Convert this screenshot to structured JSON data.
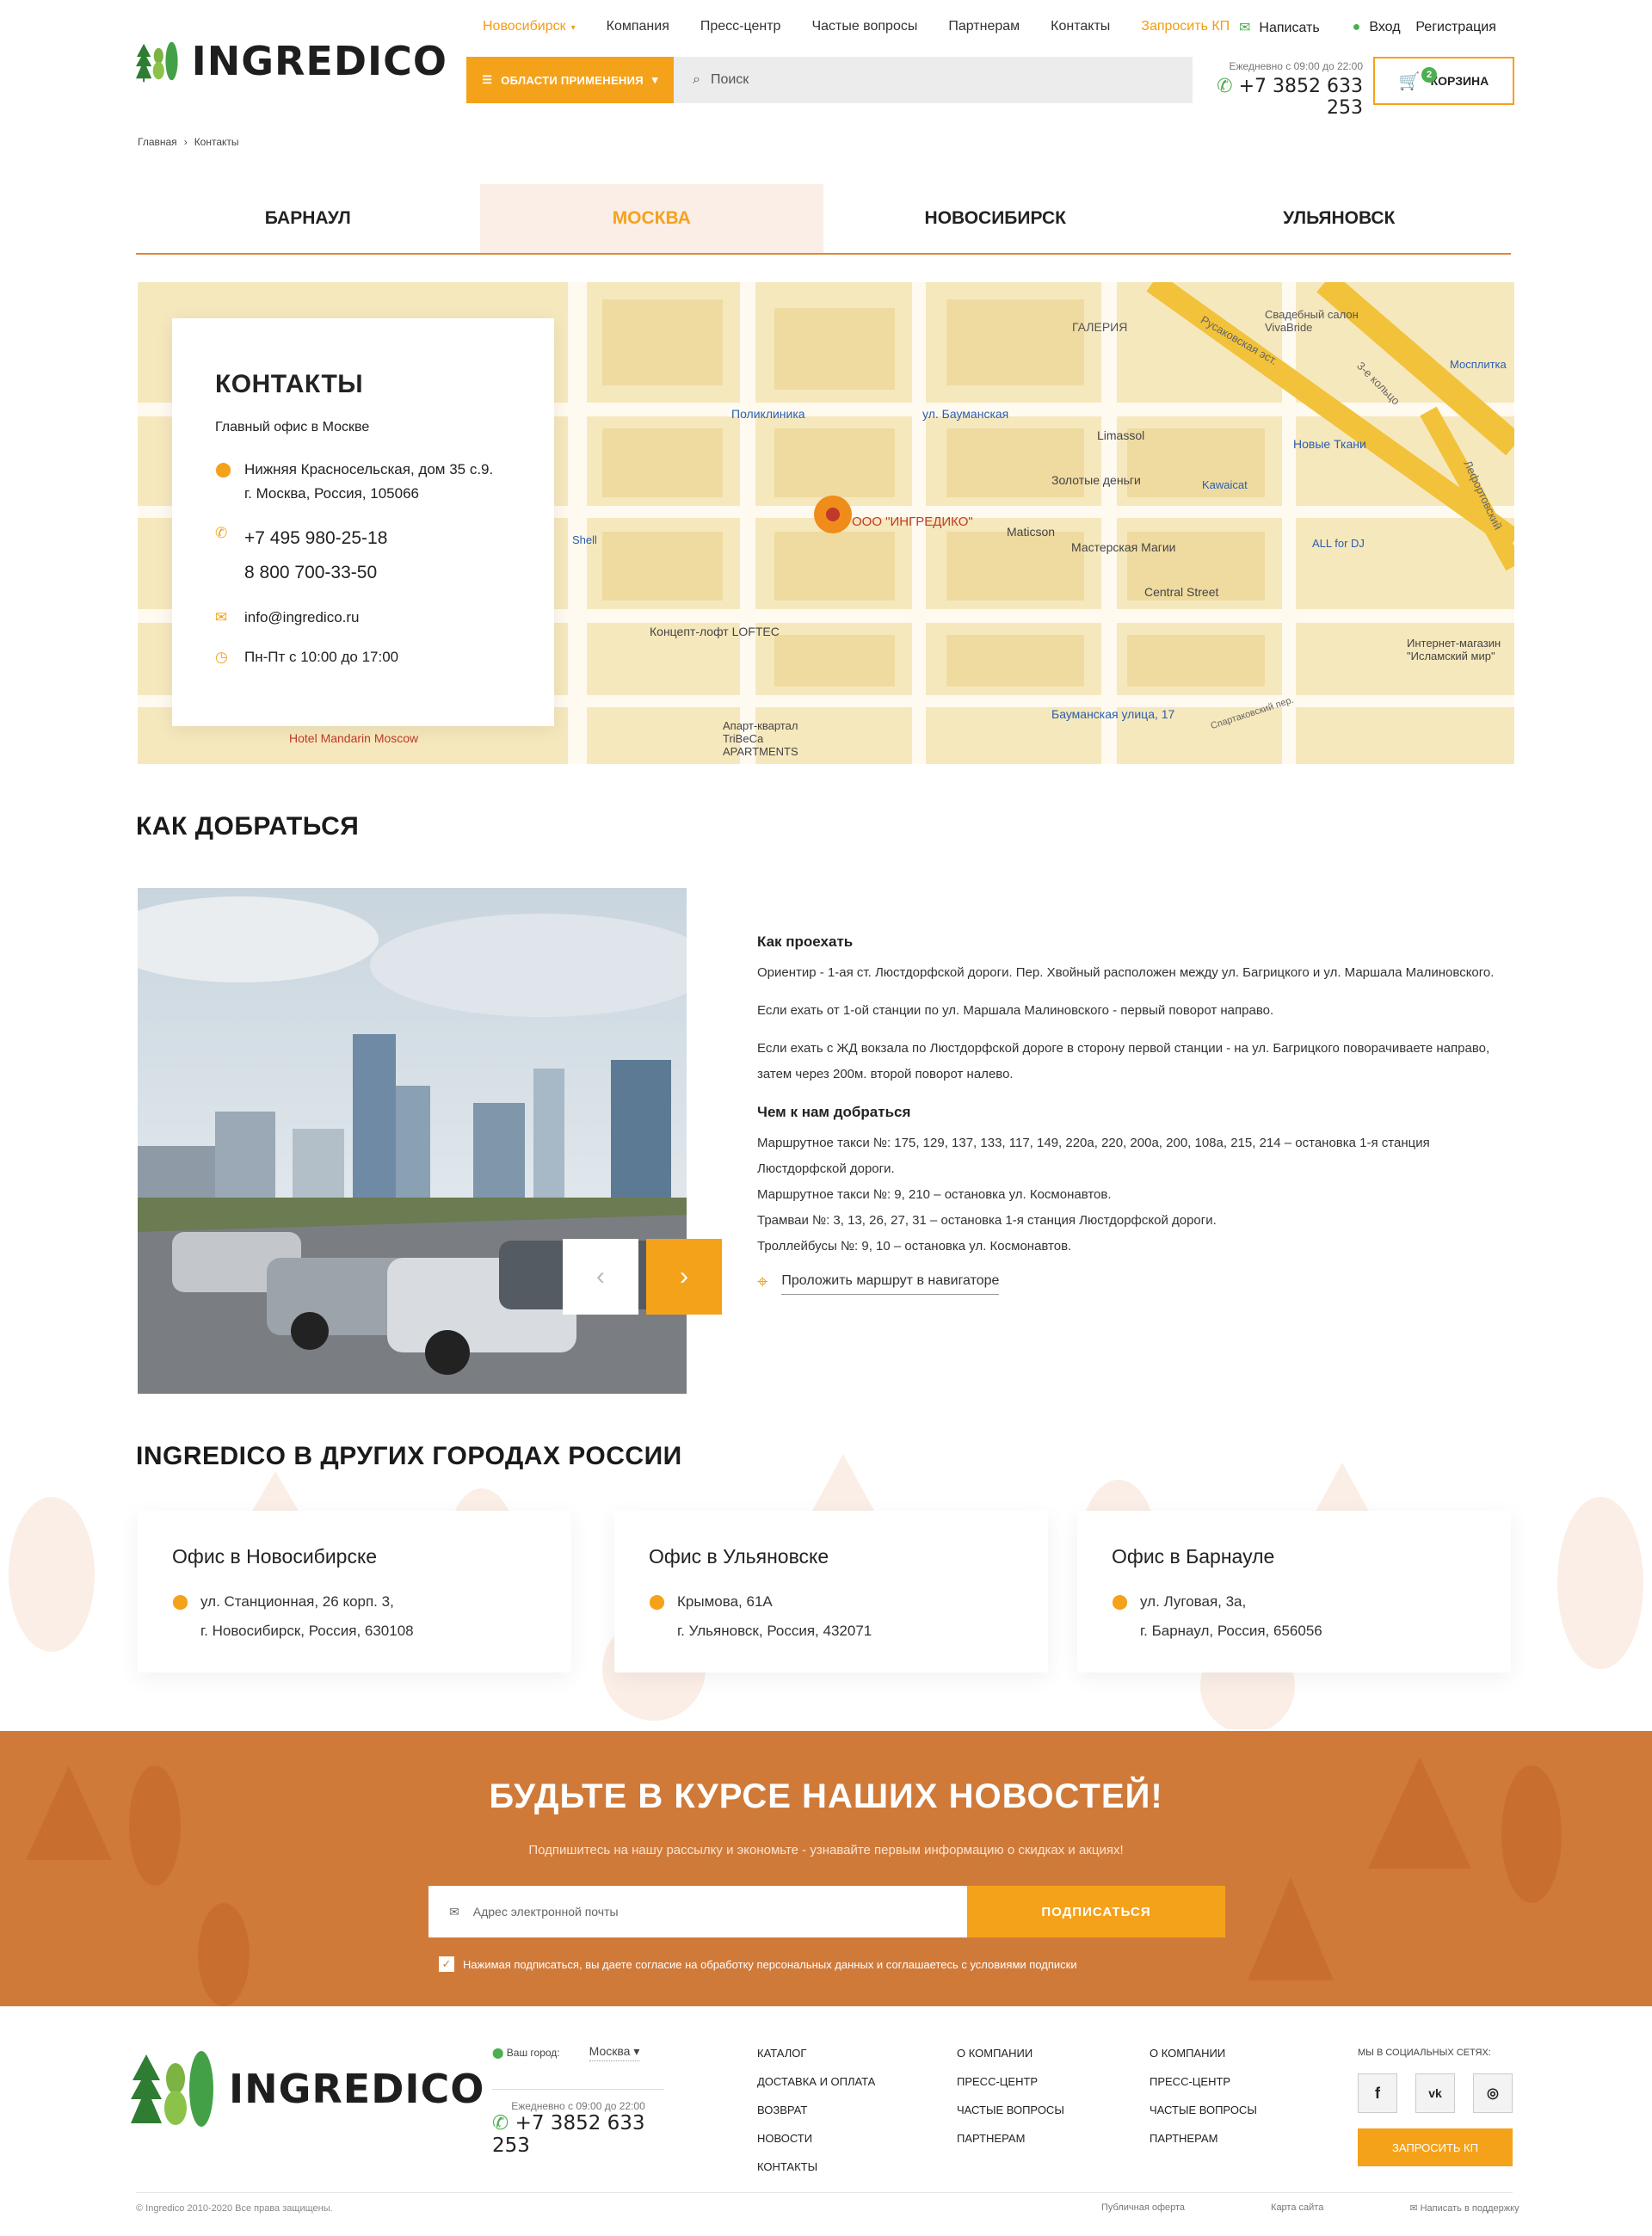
{
  "header": {
    "logo_text": "INGREDICO",
    "nav": [
      "Компания",
      "Пресс-центр",
      "Частые вопросы",
      "Партнерам",
      "Контакты"
    ],
    "city": "Новосибирск",
    "request_kp": "Запросить КП",
    "write": "Написать",
    "login": "Вход",
    "register": "Регистрация",
    "areas_button": "ОБЛАСТИ ПРИМЕНЕНИЯ",
    "search_placeholder": "Поиск",
    "hours": "Ежедневно с 09:00 до 22:00",
    "phone": "+7 3852 633 253",
    "cart_label": "КОРЗИНА",
    "cart_count": "2"
  },
  "breadcrumb": [
    "Главная",
    "Контакты"
  ],
  "tabs": [
    "БАРНАУЛ",
    "МОСКВА",
    "НОВОСИБИРСК",
    "УЛЬЯНОВСК"
  ],
  "active_tab": 1,
  "contacts": {
    "title": "КОНТАКТЫ",
    "office": "Главный офис в Москве",
    "address_1": "Нижняя Красносельская, дом 35 с.9.",
    "address_2": "г. Москва, Россия, 105066",
    "phone_1": "+7 495 980-25-18",
    "phone_2": "8 800 700-33-50",
    "email": "info@ingredico.ru",
    "hours": "Пн-Пт с 10:00 до 17:00"
  },
  "map": {
    "company_pin": "ООО \"ИНГРЕДИКО\"",
    "labels": [
      "Поликлиника",
      "ул. Бауманская",
      "Limassol",
      "ГАЛЕРИЯ",
      "Свадебный салон VivaBride",
      "Мосплитка",
      "Новые Ткани",
      "Золотые деньги",
      "Kawaicat",
      "Maticson",
      "Мастерская Магии",
      "ALL for DJ",
      "Central Street",
      "Концепт-лофт LOFTEC",
      "Shell",
      "Апарт-квартал TriBeCa APARTMENTS",
      "Hotel Mandarin Moscow",
      "Бауманская улица, 17",
      "Интернет-магазин \"Исламский мир\"",
      "Русаковская эст.",
      "3-е кольцо",
      "Спартаковский пер.",
      "Лефортовский"
    ]
  },
  "directions": {
    "title": "КАК ДОБРАТЬСЯ",
    "how_title": "Как проехать",
    "how_p1": "Ориентир - 1-ая ст. Люстдорфской дороги. Пер. Хвойный расположен между ул. Багрицкого и ул. Маршала Малиновского.",
    "how_p2": "Если ехать от 1-ой станции по ул. Маршала Малиновского - первый поворот направо.",
    "how_p3": "Если ехать с ЖД вокзала по Люстдорфской дороге в сторону первой станции - на ул. Багрицкого поворачиваете направо, затем через 200м. второй поворот налево.",
    "transport_title": "Чем к нам добраться",
    "transport": [
      "Маршрутное такси №: 175, 129, 137, 133, 117, 149, 220а, 220, 200а, 200, 108а, 215, 214 – остановка 1-я станция Люстдорфской дороги.",
      "Маршрутное такси №: 9, 210 – остановка ул. Космонавтов.",
      "Трамваи №: 3, 13, 26, 27, 31 – остановка 1-я станция Люстдорфской дороги.",
      "Троллейбусы №: 9, 10 – остановка ул. Космонавтов."
    ],
    "route_link": "Проложить маршрут в навигаторе"
  },
  "other_cities": {
    "title": "INGREDICO В ДРУГИХ ГОРОДАХ РОССИИ",
    "offices": [
      {
        "name": "Офис в Новосибирске",
        "line1": "ул. Станционная, 26 корп. 3,",
        "line2": "г. Новосибирск, Россия, 630108"
      },
      {
        "name": "Офис в Ульяновске",
        "line1": "Крымова, 61А",
        "line2": "г. Ульяновск, Россия, 432071"
      },
      {
        "name": "Офис в Барнауле",
        "line1": "ул. Луговая, 3а,",
        "line2": "г. Барнаул, Россия, 656056"
      }
    ]
  },
  "newsletter": {
    "title": "БУДЬТЕ В КУРСЕ НАШИХ НОВОСТЕЙ!",
    "subtitle": "Подпишитесь на нашу рассылку и экономьте - узнавайте первым информацию о скидках и акциях!",
    "email_placeholder": "Адрес электронной почты",
    "button": "ПОДПИСАТЬСЯ",
    "consent": "Нажимая подписаться, вы даете согласие на обработку персональных данных и соглашаетесь с условиями подписки"
  },
  "footer": {
    "city_label": "Ваш город:",
    "city": "Москва",
    "hours": "Ежедневно с 09:00 до 22:00",
    "phone": "+7 3852 633 253",
    "col1": [
      "КАТАЛОГ",
      "ДОСТАВКА И ОПЛАТА",
      "ВОЗВРАТ",
      "НОВОСТИ",
      "КОНТАКТЫ"
    ],
    "col2": [
      "О КОМПАНИИ",
      "ПРЕСС-ЦЕНТР",
      "ЧАСТЫЕ ВОПРОСЫ",
      "ПАРТНЕРАМ"
    ],
    "col3": [
      "О КОМПАНИИ",
      "ПРЕСС-ЦЕНТР",
      "ЧАСТЫЕ ВОПРОСЫ",
      "ПАРТНЕРАМ"
    ],
    "social_title": "МЫ В СОЦИАЛЬНЫХ СЕТЯХ:",
    "request_button": "ЗАПРОСИТЬ КП",
    "copyright": "© Ingredico 2010-2020 Все права защищены.",
    "links": [
      "Публичная оферта",
      "Карта сайта",
      "Написать в поддержку"
    ]
  }
}
